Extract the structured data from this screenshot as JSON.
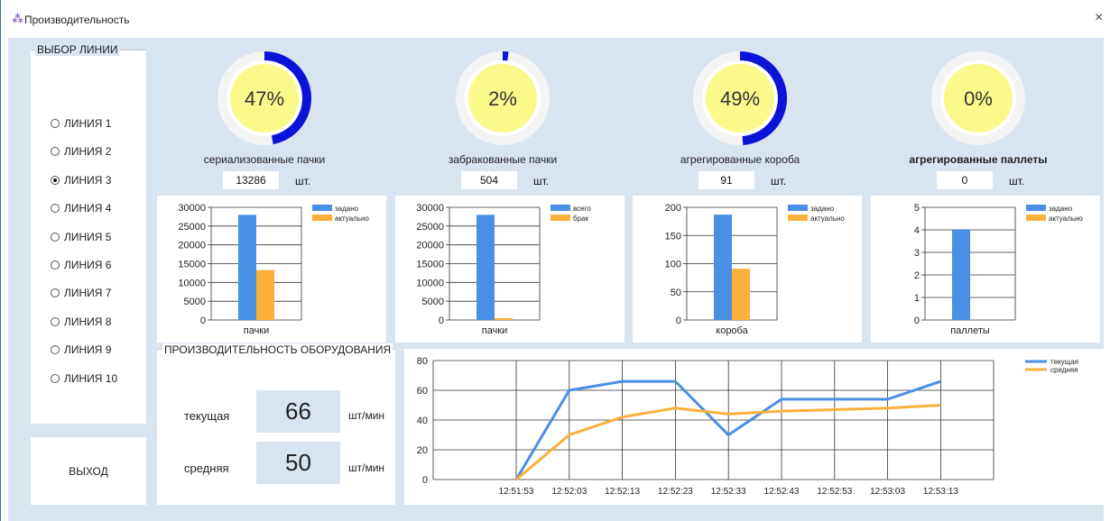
{
  "window": {
    "title": "Производительность",
    "icon": "app-icon",
    "close": "×"
  },
  "line_select": {
    "legend": "ВЫБОР ЛИНИИ",
    "options": [
      "ЛИНИЯ 1",
      "ЛИНИЯ 2",
      "ЛИНИЯ 3",
      "ЛИНИЯ 4",
      "ЛИНИЯ 5",
      "ЛИНИЯ 6",
      "ЛИНИЯ 7",
      "ЛИНИЯ 8",
      "ЛИНИЯ 9",
      "ЛИНИЯ 10"
    ],
    "selected_index": 2
  },
  "exit_button": "ВЫХОД",
  "metrics": [
    {
      "percent_text": "47%",
      "percent": 47,
      "label": "сериализованные пачки",
      "value": "13286",
      "unit": "шт."
    },
    {
      "percent_text": "2%",
      "percent": 2,
      "label": "забракованные пачки",
      "value": "504",
      "unit": "шт."
    },
    {
      "percent_text": "49%",
      "percent": 49,
      "label": "агрегированные короба",
      "value": "91",
      "unit": "шт."
    },
    {
      "percent_text": "0%",
      "percent": 0,
      "label": "агрегированные паллеты",
      "value": "0",
      "unit": "шт."
    }
  ],
  "colors": {
    "gauge_fill": "#0a14d8",
    "gauge_bg": "#f4f4f4",
    "gauge_center": "#fafa8c",
    "bar_blue": "#4a8fe6",
    "bar_orange": "#fbb03b",
    "line_blue": "#4a8fe6",
    "line_orange": "#fbb03b"
  },
  "chart_data": [
    {
      "type": "bar",
      "categories": [
        "пачки"
      ],
      "yticks": [
        "30000",
        "25000",
        "20000",
        "15000",
        "10000",
        "5000",
        "0"
      ],
      "ylim": [
        0,
        30000
      ],
      "series": [
        {
          "name": "задано",
          "values": [
            28000
          ]
        },
        {
          "name": "актуально",
          "values": [
            13286
          ]
        }
      ]
    },
    {
      "type": "bar",
      "categories": [
        "пачки"
      ],
      "yticks": [
        "30000",
        "25000",
        "20000",
        "15000",
        "10000",
        "5000",
        "0"
      ],
      "ylim": [
        0,
        30000
      ],
      "series": [
        {
          "name": "всего",
          "values": [
            28000
          ]
        },
        {
          "name": "брак",
          "values": [
            504
          ]
        }
      ]
    },
    {
      "type": "bar",
      "categories": [
        "короба"
      ],
      "yticks": [
        "200",
        "150",
        "100",
        "50",
        "0"
      ],
      "ylim": [
        0,
        200
      ],
      "series": [
        {
          "name": "задано",
          "values": [
            187
          ]
        },
        {
          "name": "актуально",
          "values": [
            91
          ]
        }
      ]
    },
    {
      "type": "bar",
      "categories": [
        "паллеты"
      ],
      "yticks": [
        "5",
        "4",
        "3",
        "2",
        "1",
        "0"
      ],
      "ylim": [
        0,
        5
      ],
      "series": [
        {
          "name": "задано",
          "values": [
            4
          ]
        },
        {
          "name": "актуально",
          "values": [
            0
          ]
        }
      ]
    },
    {
      "type": "line",
      "x": [
        "12:51:53",
        "12:52:03",
        "12:52:13",
        "12:52:23",
        "12:52:33",
        "12:52:43",
        "12:52:53",
        "12:53:03",
        "12:53:13"
      ],
      "yticks": [
        "80",
        "60",
        "40",
        "20",
        "0"
      ],
      "ylim": [
        0,
        80
      ],
      "series": [
        {
          "name": "текущая",
          "values": [
            0,
            60,
            66,
            66,
            30,
            54,
            54,
            54,
            66
          ]
        },
        {
          "name": "средняя",
          "values": [
            0,
            30,
            42,
            48,
            44,
            46,
            47,
            48,
            50
          ]
        }
      ]
    }
  ],
  "performance": {
    "legend": "ПРОИЗВОДИТЕЛЬНОСТЬ ОБОРУДОВАНИЯ",
    "current_label": "текущая",
    "current_value": "66",
    "current_unit": "шт/мин",
    "average_label": "средняя",
    "average_value": "50",
    "average_unit": "шт/мин"
  }
}
